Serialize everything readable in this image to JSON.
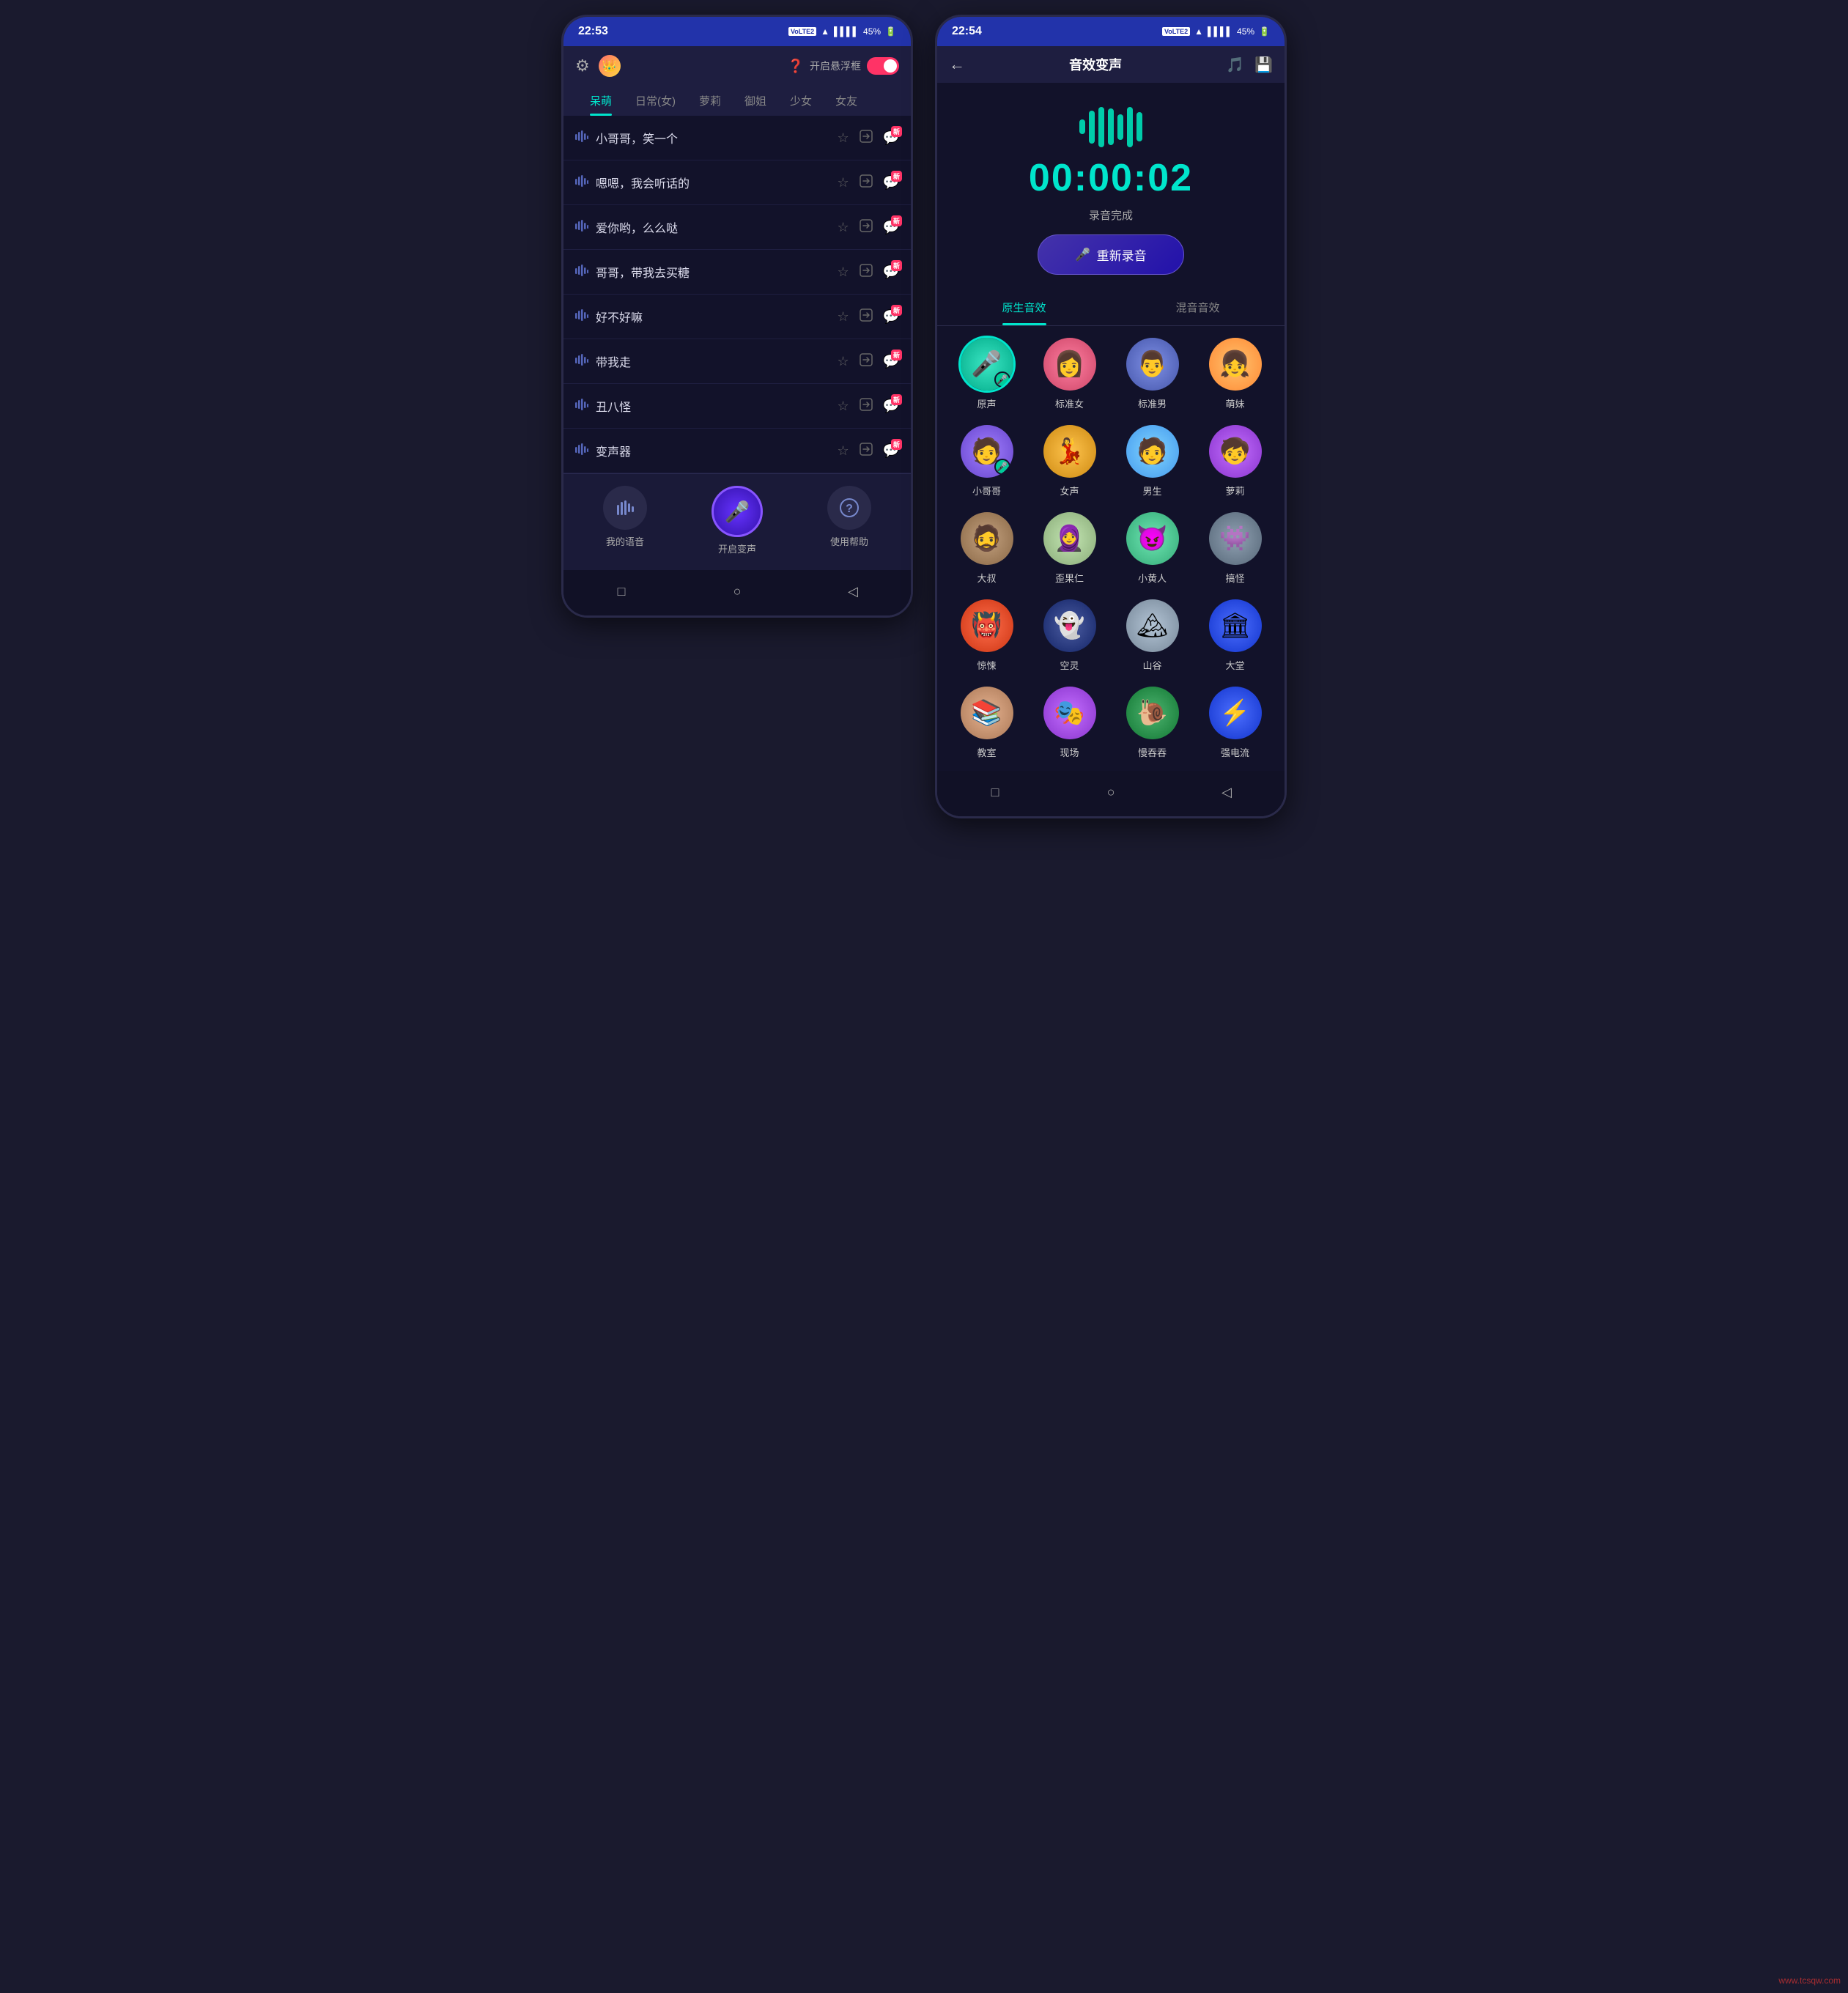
{
  "left_phone": {
    "status_bar": {
      "time": "22:53",
      "volte": "VoLTE2",
      "battery": "45%"
    },
    "header": {
      "help_label": "开启悬浮框",
      "toggle_state": "on"
    },
    "tabs": [
      "呆萌",
      "日常(女)",
      "萝莉",
      "御姐",
      "少女",
      "女友"
    ],
    "active_tab": 0,
    "songs": [
      {
        "name": "小哥哥，笑一个",
        "new": true
      },
      {
        "name": "嗯嗯，我会听话的",
        "new": true
      },
      {
        "name": "爱你哟，么么哒",
        "new": true
      },
      {
        "name": "哥哥，带我去买糖",
        "new": true
      },
      {
        "name": "好不好嘛",
        "new": true
      },
      {
        "name": "带我走",
        "new": true
      },
      {
        "name": "丑八怪",
        "new": true
      },
      {
        "name": "变声器",
        "new": true
      }
    ],
    "bottom_nav": [
      {
        "icon": "waveform",
        "label": "我的语音"
      },
      {
        "icon": "mic",
        "label": "开启变声"
      },
      {
        "icon": "help",
        "label": "使用帮助"
      }
    ],
    "system_bar": {
      "square": "□",
      "circle": "○",
      "triangle": "◁"
    }
  },
  "right_phone": {
    "status_bar": {
      "time": "22:54",
      "volte": "VoLTE2",
      "battery": "45%"
    },
    "header": {
      "title": "音效变声",
      "back_icon": "←",
      "list_icon": "≡",
      "save_icon": "⬜"
    },
    "recording": {
      "timer": "00:00:02",
      "status": "录音完成",
      "re_record_label": "重新录音"
    },
    "effect_tabs": [
      "原生音效",
      "混音音效"
    ],
    "active_effect_tab": 0,
    "effects": [
      {
        "name": "原声",
        "emoji": "🎤",
        "color": "avatar-teal",
        "selected": true,
        "mic": true
      },
      {
        "name": "标准女",
        "emoji": "👩",
        "color": "avatar-pink"
      },
      {
        "name": "标准男",
        "emoji": "👨",
        "color": "avatar-blue"
      },
      {
        "name": "萌妹",
        "emoji": "👧",
        "color": "avatar-orange"
      },
      {
        "name": "小哥哥",
        "emoji": "🧑",
        "color": "avatar-purple",
        "selected2": true,
        "mic": true
      },
      {
        "name": "女声",
        "emoji": "💃",
        "color": "avatar-yellow"
      },
      {
        "name": "男生",
        "emoji": "🧑",
        "color": "avatar-lightblue"
      },
      {
        "name": "萝莉",
        "emoji": "🧒",
        "color": "avatar-violet"
      },
      {
        "name": "大叔",
        "emoji": "🧔",
        "color": "avatar-brown"
      },
      {
        "name": "歪果仁",
        "emoji": "🧕",
        "color": "avatar-white"
      },
      {
        "name": "小黄人",
        "emoji": "😈",
        "color": "avatar-mint"
      },
      {
        "name": "搞怪",
        "emoji": "👾",
        "color": "avatar-dark"
      },
      {
        "name": "惊悚",
        "emoji": "👹",
        "color": "avatar-red"
      },
      {
        "name": "空灵",
        "emoji": "👻",
        "color": "avatar-navy"
      },
      {
        "name": "山谷",
        "emoji": "🏔️",
        "color": "avatar-gray"
      },
      {
        "name": "大堂",
        "emoji": "🏛️",
        "color": "avatar-electric"
      },
      {
        "name": "教室",
        "emoji": "📚",
        "color": "avatar-snail"
      },
      {
        "name": "现场",
        "emoji": "🎭",
        "color": "avatar-violet"
      },
      {
        "name": "慢吞吞",
        "emoji": "🐌",
        "color": "avatar-green"
      },
      {
        "name": "强电流",
        "emoji": "⚡",
        "color": "avatar-electric"
      }
    ],
    "system_bar": {
      "square": "□",
      "circle": "○",
      "triangle": "◁"
    }
  },
  "watermark": "www.tcsqw.com"
}
